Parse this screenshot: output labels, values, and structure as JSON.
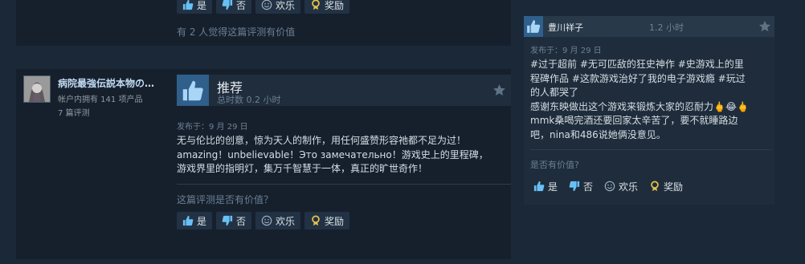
{
  "top_review": {
    "votes": {
      "yes": "是",
      "no": "否",
      "funny": "欢乐",
      "award": "奖励"
    },
    "helpful_count": "有 2 人觉得这篇评测有价值"
  },
  "main_review": {
    "author": {
      "name": "病院最強伝説本物の…",
      "products": "帐户内拥有 141 项产品",
      "reviews": "7 篇评测"
    },
    "recommendation": "推荐",
    "hours": "总时数 0.2 小时",
    "posted": "发布于：9 月 29 日",
    "text": "无与伦比的创意，惊为天人的制作，用任何盛赞形容祂都不足为过！\namazing！unbelievable！Это замечательно！游戏史上的里程碑，\n游戏界里的指明灯，集万千智慧于一体，真正的旷世奇作！",
    "helpful_prompt": "这篇评测是否有价值？",
    "votes": {
      "yes": "是",
      "no": "否",
      "funny": "欢乐",
      "award": "奖励"
    }
  },
  "side_review": {
    "author": "豊川祥子",
    "hours": "1.2 小时",
    "posted": "发布于：9 月 29 日",
    "text": "#过于超前 #无可匹敌的狂史神作 #史游戏上的里\n程碑作品 #这款游戏治好了我的电子游戏瘾 #玩过\n的人都哭了\n感谢东映做出这个游戏来锻炼大家的忍耐力🖕😂🖕\nmmk桑喝完酒还要回家太辛苦了，要不就睡路边\n吧，nina和486说她俩没意见。",
    "helpful_prompt": "是否有价值?",
    "votes": {
      "yes": "是",
      "no": "否",
      "funny": "欢乐",
      "award": "奖励"
    }
  },
  "colors": {
    "background": "#1b2838",
    "card": "#16202d",
    "accent_blue": "#2f5f8a",
    "award_gold": "#e5c24b"
  },
  "icons": {
    "yes": "thumbs-up-icon",
    "no": "thumbs-down-icon",
    "funny": "smiley-icon",
    "award": "award-medal-icon",
    "recommend": "thumbs-up-icon",
    "options": "star-icon"
  }
}
